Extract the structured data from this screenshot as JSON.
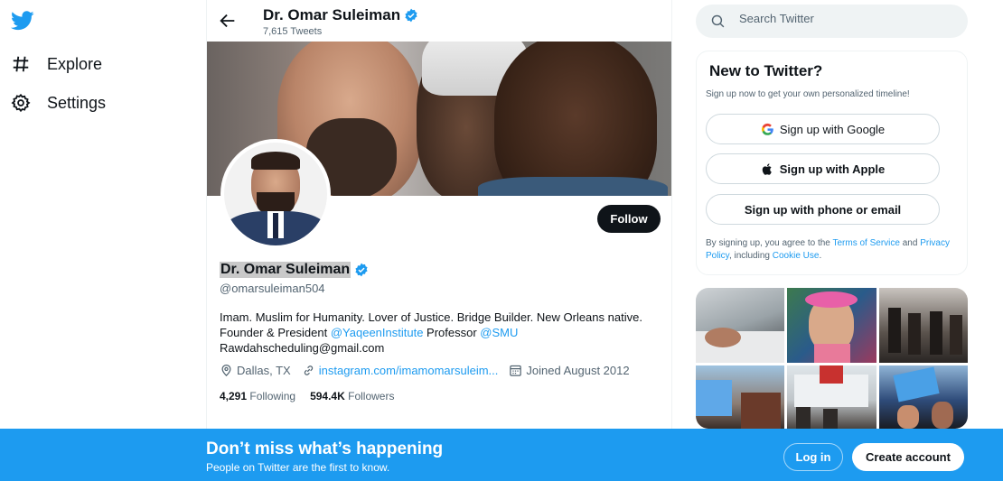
{
  "nav": {
    "logo_icon": "twitter-bird-icon",
    "items": [
      {
        "label": "Explore",
        "icon": "hashtag-icon"
      },
      {
        "label": "Settings",
        "icon": "gear-icon"
      }
    ]
  },
  "header": {
    "name": "Dr. Omar Suleiman",
    "tweets": "7,615 Tweets"
  },
  "profile": {
    "name": "Dr. Omar Suleiman",
    "handle": "@omarsuleiman504",
    "follow_label": "Follow",
    "bio_line1": "Imam. Muslim for Humanity. Lover of Justice. Bridge Builder. New Orleans native.",
    "bio_line2_prefix": "Founder & President ",
    "bio_link1": "@YaqeenInstitute",
    "bio_line2_mid": " Professor ",
    "bio_link2": "@SMU",
    "bio_line3": "Rawdahscheduling@gmail.com",
    "location": "Dallas, TX",
    "website": "instagram.com/imamomarsuleim...",
    "joined": "Joined August 2012",
    "following_count": "4,291",
    "following_label": "Following",
    "followers_count": "594.4K",
    "followers_label": "Followers"
  },
  "search": {
    "placeholder": "Search Twitter"
  },
  "new_to_twitter": {
    "title": "New to Twitter?",
    "subtitle": "Sign up now to get your own personalized timeline!",
    "google_label": "Sign up with Google",
    "apple_label": "Sign up with Apple",
    "phone_label": "Sign up with phone or email",
    "terms_prefix": "By signing up, you agree to the ",
    "terms_link": "Terms of Service",
    "terms_and": " and ",
    "privacy_link": "Privacy Policy",
    "terms_including": ", including ",
    "cookie_link": "Cookie Use",
    "terms_end": "."
  },
  "bottom_bar": {
    "title": "Don’t miss what’s happening",
    "subtitle": "People on Twitter are the first to know.",
    "login_label": "Log in",
    "create_label": "Create account"
  },
  "colors": {
    "accent": "#1d9bf0",
    "text": "#0f1419",
    "muted": "#536471"
  }
}
